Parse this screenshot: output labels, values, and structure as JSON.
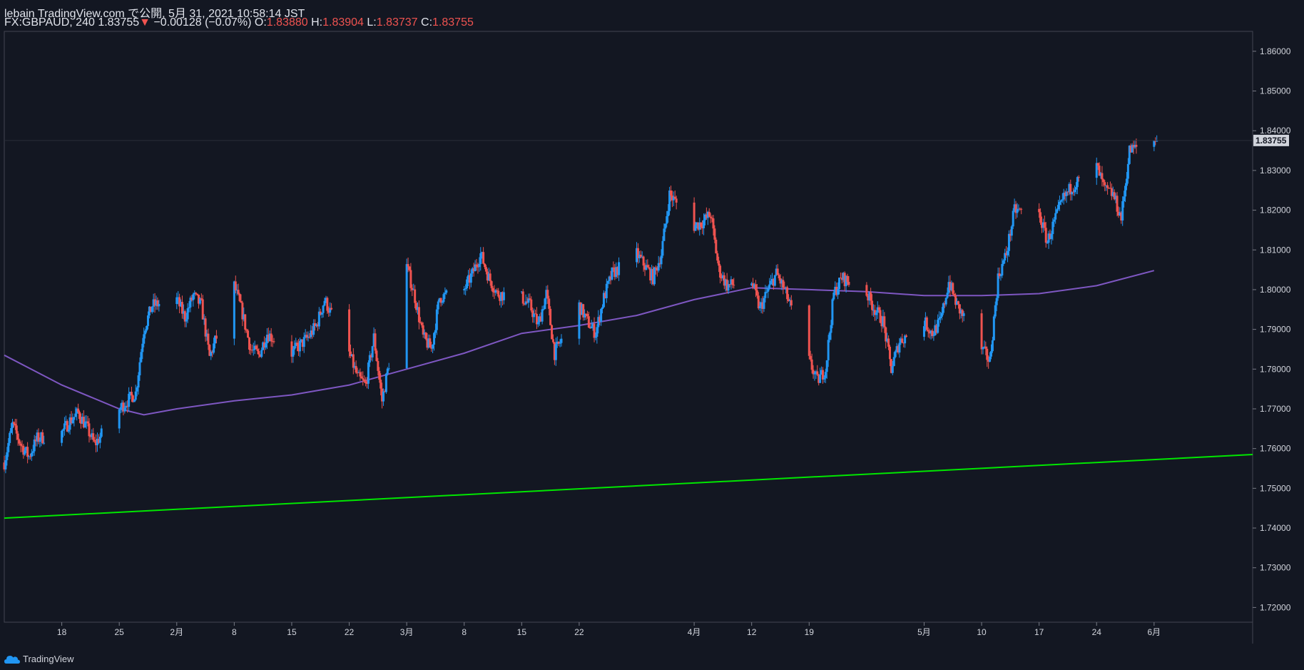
{
  "header": {
    "line1": "lebain TradingView.com で公開, 5月 31, 2021 10:58:14 JST",
    "symbol": "FX:GBPAUD, 240",
    "last": "1.83755",
    "change": "−0.00128 (−0.07%)",
    "o_label": "O:",
    "o_val": "1.83880",
    "h_label": "H:",
    "h_val": "1.83904",
    "l_label": "L:",
    "l_val": "1.83737",
    "c_label": "C:",
    "c_val": "1.83755"
  },
  "footer": {
    "brand": "TradingView"
  },
  "colors": {
    "up": "#2196f3",
    "down": "#ef5350",
    "ma": "#7e57c2",
    "trend": "#00e600",
    "grid": "#1e222d",
    "bg": "#131722"
  },
  "chart_data": {
    "type": "candlestick",
    "symbol": "FX:GBPAUD",
    "interval": "240",
    "y_ticks": [
      1.72,
      1.73,
      1.74,
      1.75,
      1.76,
      1.77,
      1.78,
      1.79,
      1.8,
      1.81,
      1.82,
      1.83,
      1.84,
      1.85,
      1.86
    ],
    "y_tick_labels": [
      "1.72000",
      "1.73000",
      "1.74000",
      "1.75000",
      "1.76000",
      "1.77000",
      "1.78000",
      "1.79000",
      "1.80000",
      "1.81000",
      "1.82000",
      "1.83000",
      "1.84000",
      "1.85000",
      "1.86000"
    ],
    "ylim": [
      1.7163,
      1.865
    ],
    "x_labels": [
      "18",
      "25",
      "2月",
      "8",
      "15",
      "22",
      "3月",
      "8",
      "15",
      "22",
      "4月",
      "12",
      "19",
      "5月",
      "10",
      "17",
      "24",
      "6月"
    ],
    "x_label_dates": [
      "2021-01-18",
      "2021-01-25",
      "2021-02-01",
      "2021-02-08",
      "2021-02-15",
      "2021-02-22",
      "2021-03-01",
      "2021-03-08",
      "2021-03-15",
      "2021-03-22",
      "2021-04-05",
      "2021-04-12",
      "2021-04-19",
      "2021-05-03",
      "2021-05-10",
      "2021-05-17",
      "2021-05-24",
      "2021-05-31"
    ],
    "xlim": [
      "2021-01-11",
      "2021-06-12"
    ],
    "last_price": 1.83755,
    "last_price_label": "1.83755",
    "price_path": [
      [
        "2021-01-11",
        1.7565
      ],
      [
        "2021-01-12",
        1.766
      ],
      [
        "2021-01-13",
        1.761
      ],
      [
        "2021-01-14",
        1.758
      ],
      [
        "2021-01-15",
        1.7625
      ],
      [
        "2021-01-18",
        1.764
      ],
      [
        "2021-01-19",
        1.767
      ],
      [
        "2021-01-20",
        1.769
      ],
      [
        "2021-01-21",
        1.7655
      ],
      [
        "2021-01-22",
        1.761
      ],
      [
        "2021-01-25",
        1.77
      ],
      [
        "2021-01-26",
        1.772
      ],
      [
        "2021-01-27",
        1.774
      ],
      [
        "2021-01-28",
        1.79
      ],
      [
        "2021-01-29",
        1.796
      ],
      [
        "2021-02-01",
        1.7975
      ],
      [
        "2021-02-02",
        1.793
      ],
      [
        "2021-02-03",
        1.7985
      ],
      [
        "2021-02-04",
        1.796
      ],
      [
        "2021-02-05",
        1.783
      ],
      [
        "2021-02-08",
        1.801
      ],
      [
        "2021-02-09",
        1.794
      ],
      [
        "2021-02-10",
        1.785
      ],
      [
        "2021-02-11",
        1.7835
      ],
      [
        "2021-02-12",
        1.789
      ],
      [
        "2021-02-15",
        1.784
      ],
      [
        "2021-02-16",
        1.786
      ],
      [
        "2021-02-17",
        1.788
      ],
      [
        "2021-02-18",
        1.791
      ],
      [
        "2021-02-19",
        1.7975
      ],
      [
        "2021-02-22",
        1.784
      ],
      [
        "2021-02-23",
        1.778
      ],
      [
        "2021-02-24",
        1.776
      ],
      [
        "2021-02-25",
        1.788
      ],
      [
        "2021-02-26",
        1.772
      ],
      [
        "2021-03-01",
        1.806
      ],
      [
        "2021-03-02",
        1.798
      ],
      [
        "2021-03-03",
        1.788
      ],
      [
        "2021-03-04",
        1.785
      ],
      [
        "2021-03-05",
        1.798
      ],
      [
        "2021-03-08",
        1.8
      ],
      [
        "2021-03-09",
        1.804
      ],
      [
        "2021-03-10",
        1.809
      ],
      [
        "2021-03-11",
        1.803
      ],
      [
        "2021-03-12",
        1.799
      ],
      [
        "2021-03-15",
        1.798
      ],
      [
        "2021-03-16",
        1.796
      ],
      [
        "2021-03-17",
        1.791
      ],
      [
        "2021-03-18",
        1.799
      ],
      [
        "2021-03-19",
        1.784
      ],
      [
        "2021-03-22",
        1.796
      ],
      [
        "2021-03-23",
        1.792
      ],
      [
        "2021-03-24",
        1.789
      ],
      [
        "2021-03-25",
        1.798
      ],
      [
        "2021-03-26",
        1.804
      ],
      [
        "2021-03-29",
        1.809
      ],
      [
        "2021-03-30",
        1.806
      ],
      [
        "2021-03-31",
        1.803
      ],
      [
        "2021-04-01",
        1.809
      ],
      [
        "2021-04-02",
        1.824
      ],
      [
        "2021-04-05",
        1.816
      ],
      [
        "2021-04-06",
        1.817
      ],
      [
        "2021-04-07",
        1.819
      ],
      [
        "2021-04-08",
        1.805
      ],
      [
        "2021-04-09",
        1.801
      ],
      [
        "2021-04-12",
        1.802
      ],
      [
        "2021-04-13",
        1.795
      ],
      [
        "2021-04-14",
        1.8
      ],
      [
        "2021-04-15",
        1.804
      ],
      [
        "2021-04-16",
        1.8
      ],
      [
        "2021-04-19",
        1.782
      ],
      [
        "2021-04-20",
        1.777
      ],
      [
        "2021-04-21",
        1.78
      ],
      [
        "2021-04-22",
        1.799
      ],
      [
        "2021-04-23",
        1.803
      ],
      [
        "2021-04-26",
        1.799
      ],
      [
        "2021-04-27",
        1.795
      ],
      [
        "2021-04-28",
        1.792
      ],
      [
        "2021-04-29",
        1.78
      ],
      [
        "2021-04-30",
        1.787
      ],
      [
        "2021-05-03",
        1.792
      ],
      [
        "2021-05-04",
        1.789
      ],
      [
        "2021-05-05",
        1.792
      ],
      [
        "2021-05-06",
        1.802
      ],
      [
        "2021-05-07",
        1.796
      ],
      [
        "2021-05-10",
        1.785
      ],
      [
        "2021-05-11",
        1.782
      ],
      [
        "2021-05-12",
        1.803
      ],
      [
        "2021-05-13",
        1.809
      ],
      [
        "2021-05-14",
        1.82
      ],
      [
        "2021-05-17",
        1.819
      ],
      [
        "2021-05-18",
        1.812
      ],
      [
        "2021-05-19",
        1.818
      ],
      [
        "2021-05-20",
        1.823
      ],
      [
        "2021-05-21",
        1.826
      ],
      [
        "2021-05-24",
        1.831
      ],
      [
        "2021-05-25",
        1.825
      ],
      [
        "2021-05-26",
        1.824
      ],
      [
        "2021-05-27",
        1.818
      ],
      [
        "2021-05-28",
        1.835
      ],
      [
        "2021-05-31",
        1.83755
      ]
    ],
    "moving_average": [
      [
        "2021-01-11",
        1.7835
      ],
      [
        "2021-01-18",
        1.776
      ],
      [
        "2021-01-25",
        1.77
      ],
      [
        "2021-01-28",
        1.7685
      ],
      [
        "2021-02-01",
        1.77
      ],
      [
        "2021-02-08",
        1.772
      ],
      [
        "2021-02-15",
        1.7735
      ],
      [
        "2021-02-22",
        1.776
      ],
      [
        "2021-03-01",
        1.78
      ],
      [
        "2021-03-08",
        1.784
      ],
      [
        "2021-03-15",
        1.789
      ],
      [
        "2021-03-22",
        1.791
      ],
      [
        "2021-03-29",
        1.7935
      ],
      [
        "2021-04-05",
        1.7975
      ],
      [
        "2021-04-12",
        1.8005
      ],
      [
        "2021-04-19",
        1.8
      ],
      [
        "2021-04-26",
        1.7995
      ],
      [
        "2021-05-03",
        1.7985
      ],
      [
        "2021-05-10",
        1.7985
      ],
      [
        "2021-05-17",
        1.799
      ],
      [
        "2021-05-24",
        1.801
      ],
      [
        "2021-05-31",
        1.8048
      ]
    ],
    "trendline": [
      [
        "2021-01-11",
        1.7425
      ],
      [
        "2021-06-12",
        1.7585
      ]
    ]
  }
}
